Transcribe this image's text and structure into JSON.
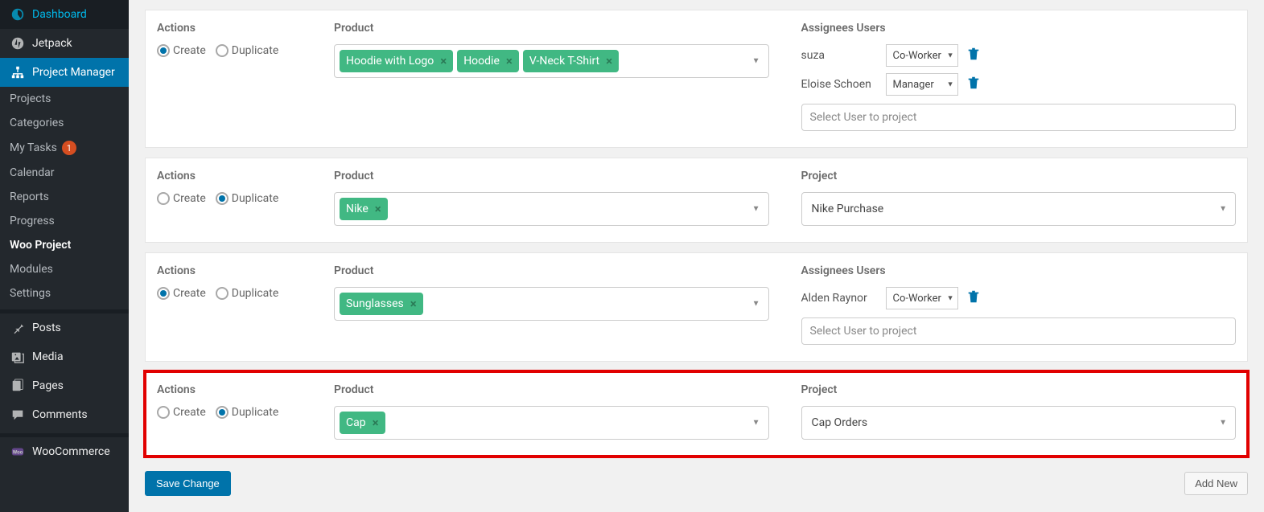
{
  "sidebar": {
    "items": [
      {
        "label": "Dashboard",
        "icon": "dashboard"
      },
      {
        "label": "Jetpack",
        "icon": "jetpack"
      },
      {
        "label": "Project Manager",
        "icon": "sitemap",
        "active": true
      }
    ],
    "sub": [
      {
        "label": "Projects"
      },
      {
        "label": "Categories"
      },
      {
        "label": "My Tasks",
        "badge": "1"
      },
      {
        "label": "Calendar"
      },
      {
        "label": "Reports"
      },
      {
        "label": "Progress"
      },
      {
        "label": "Woo Project",
        "current": true
      },
      {
        "label": "Modules"
      },
      {
        "label": "Settings"
      }
    ],
    "items2": [
      {
        "label": "Posts",
        "icon": "pin"
      },
      {
        "label": "Media",
        "icon": "media"
      },
      {
        "label": "Pages",
        "icon": "pages"
      },
      {
        "label": "Comments",
        "icon": "comments"
      }
    ],
    "items3": [
      {
        "label": "WooCommerce",
        "icon": "woo"
      }
    ]
  },
  "labels": {
    "actions": "Actions",
    "product": "Product",
    "assignees": "Assignees Users",
    "project": "Project",
    "create": "Create",
    "duplicate": "Duplicate",
    "select_user_ph": "Select User to project",
    "save": "Save Change",
    "add_new": "Add New"
  },
  "roles": {
    "co_worker": "Co-Worker",
    "manager": "Manager"
  },
  "rows": [
    {
      "action": "create",
      "products": [
        "Hoodie with Logo",
        "Hoodie",
        "V-Neck T-Shirt"
      ],
      "mode": "assignees",
      "assignees": [
        {
          "name": "suza",
          "role": "Co-Worker"
        },
        {
          "name": "Eloise Schoen",
          "role": "Manager"
        }
      ]
    },
    {
      "action": "duplicate",
      "products": [
        "Nike"
      ],
      "mode": "project",
      "project": "Nike Purchase"
    },
    {
      "action": "create",
      "products": [
        "Sunglasses"
      ],
      "mode": "assignees",
      "assignees": [
        {
          "name": "Alden Raynor",
          "role": "Co-Worker"
        }
      ]
    },
    {
      "action": "duplicate",
      "products": [
        "Cap"
      ],
      "mode": "project",
      "project": "Cap Orders",
      "highlight": true
    }
  ]
}
